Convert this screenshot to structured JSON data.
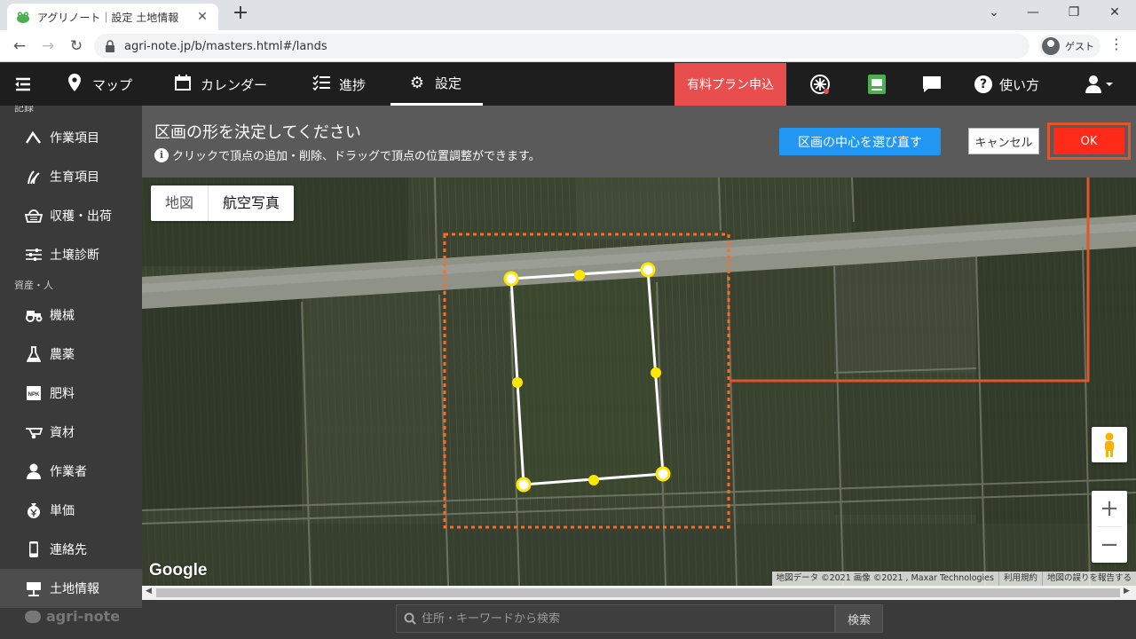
{
  "browser": {
    "tab_title": "アグリノート｜設定 土地情報",
    "url": "agri-note.jp/b/masters.html#/lands",
    "profile_label": "ゲスト"
  },
  "nav": {
    "items": [
      {
        "label": "マップ",
        "icon": "map-pin-icon"
      },
      {
        "label": "カレンダー",
        "icon": "calendar-icon"
      },
      {
        "label": "進捗",
        "icon": "checklist-icon"
      },
      {
        "label": "設定",
        "icon": "gear-icon"
      }
    ],
    "active": "設定",
    "plan_button": "有料プラン申込",
    "help_label": "使い方"
  },
  "sidebar": {
    "section_records": "記録",
    "section_assets": "資産・人",
    "items": [
      {
        "label": "作業項目",
        "icon": "work-icon"
      },
      {
        "label": "生育項目",
        "icon": "growth-icon"
      },
      {
        "label": "収穫・出荷",
        "icon": "basket-icon"
      },
      {
        "label": "土壌診断",
        "icon": "sliders-icon"
      },
      {
        "label": "機械",
        "icon": "tractor-icon"
      },
      {
        "label": "農薬",
        "icon": "flask-icon"
      },
      {
        "label": "肥料",
        "icon": "npk-icon"
      },
      {
        "label": "資材",
        "icon": "wheelbarrow-icon"
      },
      {
        "label": "作業者",
        "icon": "person-icon"
      },
      {
        "label": "単価",
        "icon": "yen-bag-icon"
      },
      {
        "label": "連絡先",
        "icon": "phone-icon"
      },
      {
        "label": "土地情報",
        "icon": "field-icon"
      }
    ],
    "active": "土地情報",
    "brand": "agri-note"
  },
  "instruction": {
    "title": "区画の形を決定してください",
    "hint": "クリックで頂点の追加・削除、ドラッグで頂点の位置調整ができます。",
    "recenter_button": "区画の中心を選び直す",
    "cancel_button": "キャンセル",
    "ok_button": "OK"
  },
  "map": {
    "map_type_options": [
      "地図",
      "航空写真"
    ],
    "map_type_selected": "航空写真",
    "logo": "Google",
    "attribution": [
      "地図データ ©2021 画像 ©2021 , Maxar Technologies",
      "利用規約",
      "地図の誤りを報告する"
    ],
    "zoom_in": "+",
    "zoom_out": "−"
  },
  "search": {
    "placeholder": "住所・キーワードから検索",
    "button": "検索"
  },
  "colors": {
    "plan_red": "#e84e4e",
    "ok_red": "#ff2a1a",
    "highlight_orange": "#e0552a",
    "recenter_blue": "#2196f3",
    "vertex_yellow": "#ffe600"
  }
}
